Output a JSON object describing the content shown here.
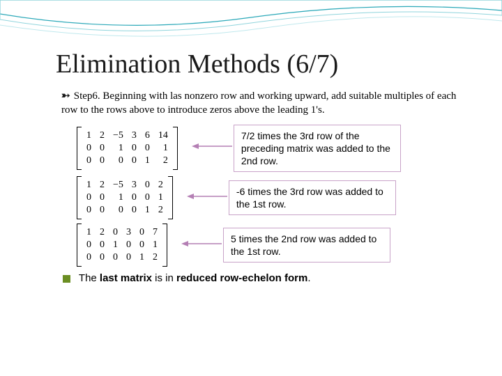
{
  "title": "Elimination Methods (6/7)",
  "step": {
    "label": "Step6.",
    "text": "Beginning with las nonzero row and working upward, add suitable multiples of each row to the rows above to introduce zeros above the leading 1's."
  },
  "matrices": {
    "m1": [
      [
        "1",
        "2",
        "−5",
        "3",
        "6",
        "14"
      ],
      [
        "0",
        "0",
        "1",
        "0",
        "0",
        "1"
      ],
      [
        "0",
        "0",
        "0",
        "0",
        "1",
        "2"
      ]
    ],
    "m2": [
      [
        "1",
        "2",
        "−5",
        "3",
        "0",
        "2"
      ],
      [
        "0",
        "0",
        "1",
        "0",
        "0",
        "1"
      ],
      [
        "0",
        "0",
        "0",
        "0",
        "1",
        "2"
      ]
    ],
    "m3": [
      [
        "1",
        "2",
        "0",
        "3",
        "0",
        "7"
      ],
      [
        "0",
        "0",
        "1",
        "0",
        "0",
        "1"
      ],
      [
        "0",
        "0",
        "0",
        "0",
        "1",
        "2"
      ]
    ]
  },
  "callouts": {
    "c1": "7/2 times the 3rd row of the preceding matrix was added to the 2nd row.",
    "c2": "-6 times the 3rd row was added to the 1st row.",
    "c3": "5 times the 2nd row was added to the 1st row."
  },
  "final": {
    "pre": "The ",
    "b1": "last matrix",
    "mid": " is in ",
    "b2": "reduced row-echelon form",
    "post": "."
  }
}
